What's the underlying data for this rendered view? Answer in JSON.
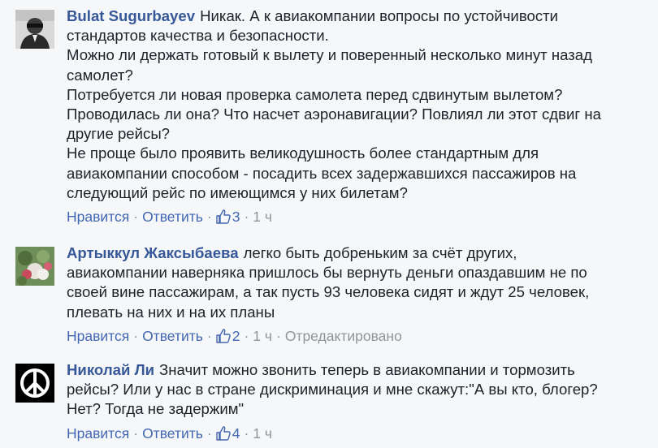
{
  "actions": {
    "like": "Нравится",
    "reply": "Ответить",
    "separator": "·",
    "edited": "Отредактировано"
  },
  "icons": {
    "like": "thumbs-up-icon",
    "peace": "peace-sign-icon"
  },
  "colors": {
    "link": "#4267b2",
    "author": "#365899",
    "meta": "#90949c",
    "background": "#f6f7f9"
  },
  "comments": [
    {
      "author": "Bulat Sugurbayev",
      "lines": [
        "Никак. А к авиакомпании вопросы по устойчивости",
        "стандартов качества и безопасности.",
        "Можно ли держать готовый к вылету и поверенный несколько минут назад",
        "самолет?",
        "Потребуется ли новая проверка самолета перед сдвинутым вылетом?",
        "Проводилась ли она? Что насчет аэронавигации? Повлиял ли этот сдвиг на",
        "другие рейсы?",
        "Не проще было проявить великодушность более стандартным для",
        "авиакомпании способом - посадить всех задержавшихся пассажиров на",
        "следующий рейс по имеющимся у них билетам?"
      ],
      "likes": "3",
      "time": "1 ч"
    },
    {
      "author": "Артыккул Жаксыбаева",
      "lines": [
        "легко быть добреньким за счёт других,",
        "авиакомпании наверняка пришлось бы вернуть деньги опаздавшим не по",
        "своей вине пассажирам, а так пусть 93 человека сидят и ждут 25 человек,",
        "плевать на них и на их планы"
      ],
      "likes": "2",
      "time": "1 ч"
    },
    {
      "author": "Николай Ли",
      "lines": [
        "Значит можно звонить теперь в авиакомпании и тормозить",
        "рейсы? Или у нас в стране дискриминация и мне скажут:\"А вы кто, блогер?",
        "Нет? Тогда не задержим\""
      ],
      "likes": "4",
      "time": "1 ч"
    }
  ]
}
